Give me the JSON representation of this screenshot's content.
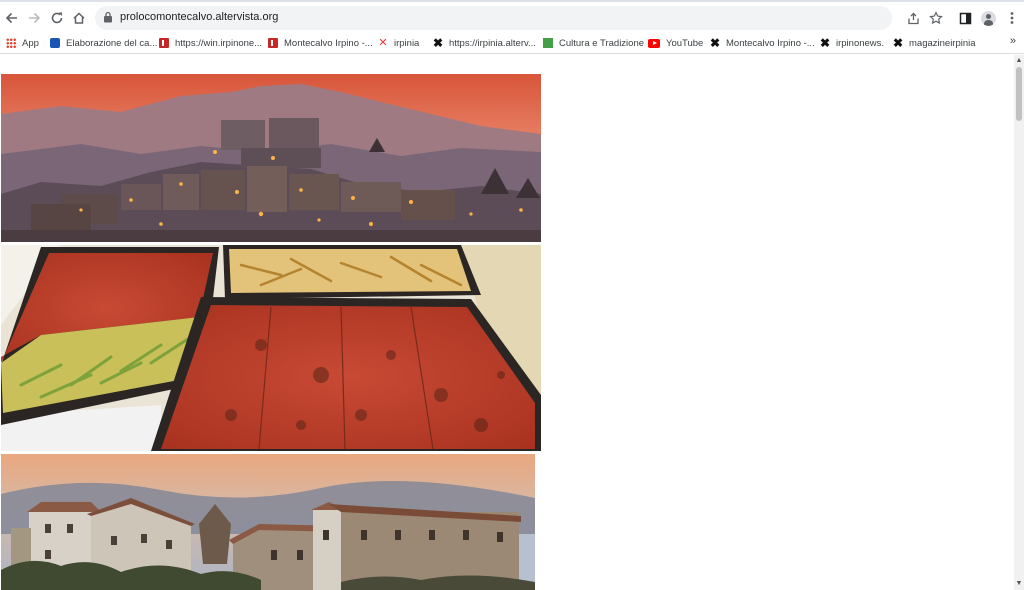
{
  "browser": {
    "url": "prolocomontecalvo.altervista.org",
    "nav": {
      "back_icon": "arrow-left-icon",
      "forward_icon": "arrow-right-icon",
      "reload_icon": "reload-icon",
      "home_icon": "home-icon"
    },
    "toolbar_icons": [
      "share-icon",
      "star-icon",
      "side-panel-icon",
      "profile-icon",
      "kebab-menu-icon"
    ]
  },
  "bookmarks": [
    {
      "label": "App",
      "icon": "apps-grid-icon"
    },
    {
      "label": "Elaborazione del ca...",
      "icon": "blue-site-icon"
    },
    {
      "label": "https://win.irpinone...",
      "icon": "red-site-icon"
    },
    {
      "label": "Montecalvo Irpino -...",
      "icon": "red-site-icon"
    },
    {
      "label": "irpinia",
      "icon": "irpinia-icon"
    },
    {
      "label": "https://irpinia.alterv...",
      "icon": "altervista-icon"
    },
    {
      "label": "Cultura e Tradizione",
      "icon": "green-site-icon"
    },
    {
      "label": "YouTube",
      "icon": "youtube-icon"
    },
    {
      "label": "Montecalvo Irpino -...",
      "icon": "altervista-icon"
    },
    {
      "label": "irpinonews.",
      "icon": "altervista-icon"
    },
    {
      "label": "magazineirpinia",
      "icon": "altervista-icon"
    }
  ],
  "bookmarks_more": "»",
  "colors": {
    "sky_sunset": "#e07a5f",
    "omnibox": "#f1f3f4",
    "tomato_red": "#b5372a",
    "stone": "#a08f7d"
  },
  "scrollbar": {
    "up": "▲",
    "down": "▼"
  }
}
